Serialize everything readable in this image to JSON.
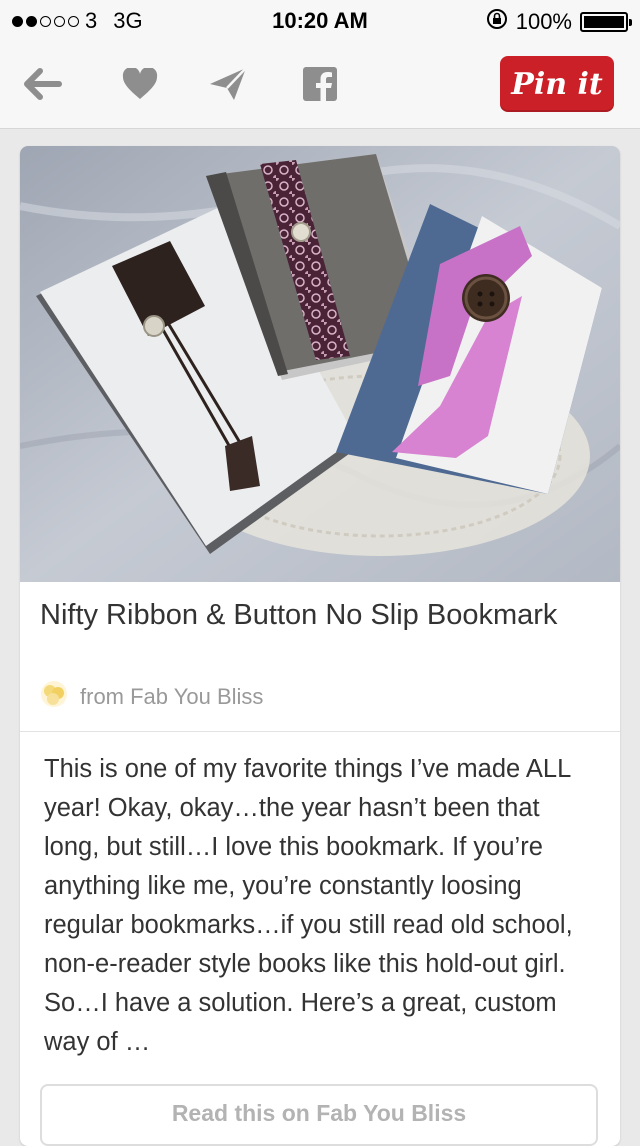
{
  "status_bar": {
    "carrier": "3",
    "network": "3G",
    "time": "10:20 AM",
    "battery": "100%",
    "signal_bars_filled": 2,
    "signal_bars_total": 5
  },
  "toolbar": {
    "back_icon": "arrow-left-icon",
    "like_icon": "heart-icon",
    "send_icon": "paper-plane-icon",
    "share_icon": "facebook-icon",
    "pin_label": "Pin it",
    "pin_color": "#cb2027"
  },
  "pin": {
    "title": "Nifty Ribbon & Button No Slip Bookmark",
    "source": "from Fab You Bliss",
    "description": "This is one of my favorite things I’ve made ALL year! Okay, okay…the year hasn’t been that long, but still…I love this bookmark. If you’re anything like me, you’re constantly loosing regular bookmarks…if you still read old school, non-e-reader style books like this hold-out girl. So…I have a solution. Here’s a great, custom way of …",
    "read_button": "Read this on Fab You Bliss"
  }
}
